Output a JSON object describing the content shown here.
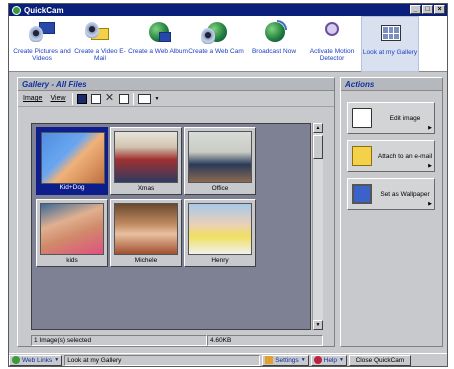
{
  "window": {
    "title": "QuickCam"
  },
  "toolbar": {
    "items": [
      {
        "label": "Create Pictures and Videos",
        "icon": "camera-film-icon"
      },
      {
        "label": "Create a Video E-Mail",
        "icon": "video-email-icon"
      },
      {
        "label": "Create a Web Album",
        "icon": "web-album-icon"
      },
      {
        "label": "Create a Web Cam",
        "icon": "web-cam-icon"
      },
      {
        "label": "Broadcast Now",
        "icon": "broadcast-icon"
      },
      {
        "label": "Activate Motion Detector",
        "icon": "motion-detector-icon"
      },
      {
        "label": "Look at my Gallery",
        "icon": "gallery-icon"
      }
    ]
  },
  "gallery": {
    "title": "Gallery - All Files",
    "menu_image": "Image",
    "menu_view": "View",
    "thumbnails": [
      {
        "caption": "Kid+Dog",
        "selected": true
      },
      {
        "caption": "Xmas",
        "selected": false
      },
      {
        "caption": "Office",
        "selected": false
      },
      {
        "caption": "kids",
        "selected": false
      },
      {
        "caption": "Michele",
        "selected": false
      },
      {
        "caption": "Henry",
        "selected": false
      }
    ],
    "status_selected": "1 Image(s) selected",
    "status_size": "4.60KB"
  },
  "actions": {
    "title": "Actions",
    "items": [
      {
        "label": "Edit image",
        "icon": "edit-image-icon"
      },
      {
        "label": "Attach to an e-mail",
        "icon": "attach-email-icon"
      },
      {
        "label": "Set as Wallpaper",
        "icon": "wallpaper-icon"
      }
    ]
  },
  "statusbar": {
    "web_links": "Web Links",
    "location": "Look at my Gallery",
    "settings": "Settings",
    "help": "Help",
    "close": "Close QuickCam"
  },
  "colors": {
    "title_bar": "#0a1f7a",
    "selection": "#0d1d8c",
    "link": "#1b3fc2"
  }
}
